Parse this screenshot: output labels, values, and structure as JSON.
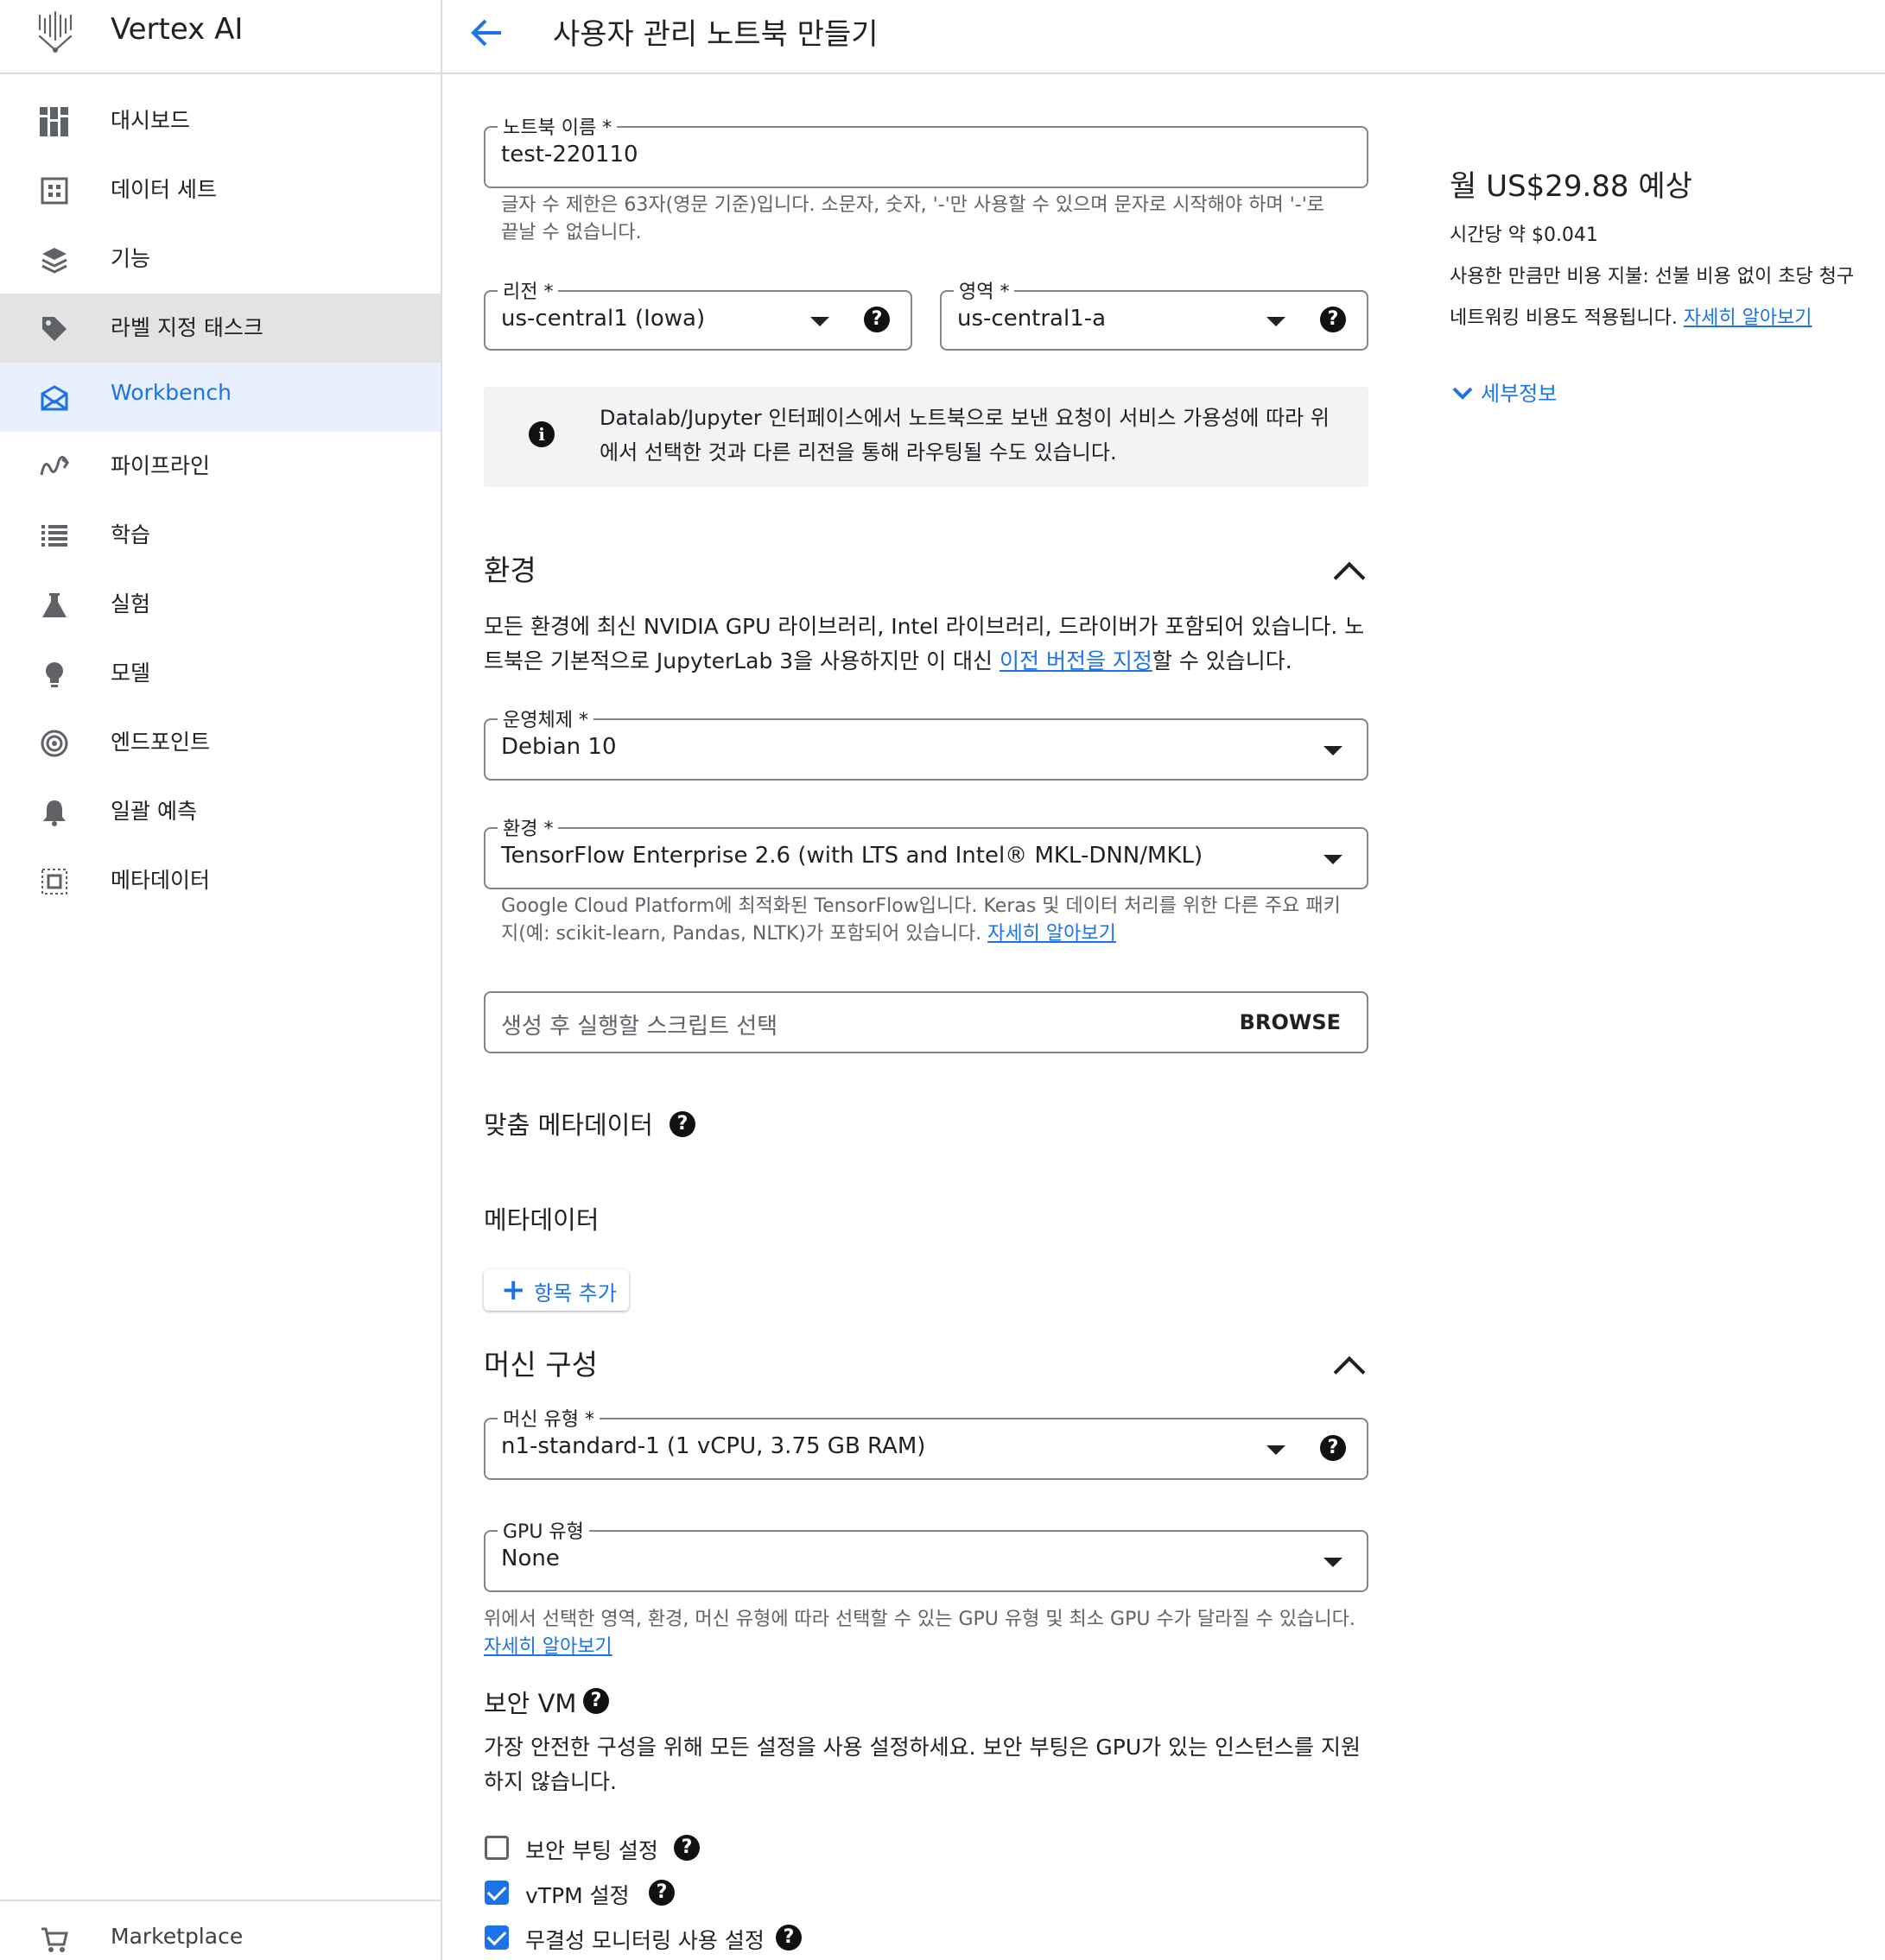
{
  "app": {
    "name": "Vertex AI"
  },
  "sidebar": {
    "items": [
      {
        "label": "대시보드",
        "icon": "dashboard-icon"
      },
      {
        "label": "데이터 세트",
        "icon": "datasets-icon"
      },
      {
        "label": "기능",
        "icon": "features-icon"
      },
      {
        "label": "라벨 지정 태스크",
        "icon": "label-tag-icon"
      },
      {
        "label": "Workbench",
        "icon": "workbench-icon"
      },
      {
        "label": "파이프라인",
        "icon": "pipelines-icon"
      },
      {
        "label": "학습",
        "icon": "training-list-icon"
      },
      {
        "label": "실험",
        "icon": "experiments-flask-icon"
      },
      {
        "label": "모델",
        "icon": "models-bulb-icon"
      },
      {
        "label": "엔드포인트",
        "icon": "endpoints-target-icon"
      },
      {
        "label": "일괄 예측",
        "icon": "batch-predictions-bell-icon"
      },
      {
        "label": "메타데이터",
        "icon": "metadata-icon"
      }
    ],
    "footer_item": {
      "label": "Marketplace",
      "icon": "marketplace-cart-icon"
    }
  },
  "header": {
    "title": "사용자 관리 노트북 만들기"
  },
  "form": {
    "notebook_name": {
      "label": "노트북 이름 *",
      "value": "test-220110",
      "hint": "글자 수 제한은 63자(영문 기준)입니다. 소문자, 숫자, '-'만 사용할 수 있으며 문자로 시작해야 하며 '-'로 끝날 수 없습니다."
    },
    "region": {
      "label": "리전 *",
      "value": "us-central1 (Iowa)"
    },
    "zone": {
      "label": "영역 *",
      "value": "us-central1-a"
    },
    "info_banner": "Datalab/Jupyter 인터페이스에서 노트북으로 보낸 요청이 서비스 가용성에 따라 위에서 선택한 것과 다른 리전을 통해 라우팅될 수도 있습니다.",
    "environment_section": {
      "title": "환경",
      "desc_before": "모든 환경에 최신 NVIDIA GPU 라이브러리, Intel 라이브러리, 드라이버가 포함되어 있습니다. 노트북은 기본적으로 JupyterLab 3을 사용하지만 이 대신 ",
      "desc_link": "이전 버전을 지정",
      "desc_after": "할 수 있습니다."
    },
    "os": {
      "label": "운영체제 *",
      "value": "Debian 10"
    },
    "environment": {
      "label": "환경 *",
      "value": "TensorFlow Enterprise 2.6 (with LTS and Intel® MKL-DNN/MKL)",
      "hint": "Google Cloud Platform에 최적화된 TensorFlow입니다. Keras 및 데이터 처리를 위한 다른 주요 패키지(예: scikit-learn, Pandas, NLTK)가 포함되어 있습니다. ",
      "hint_link": "자세히 알아보기"
    },
    "script": {
      "placeholder": "생성 후 실행할 스크립트 선택",
      "browse_label": "BROWSE"
    },
    "custom_metadata_title": "맞춤 메타데이터",
    "metadata_title": "메타데이터",
    "add_item_label": "항목 추가",
    "machine_section": {
      "title": "머신 구성"
    },
    "machine_type": {
      "label": "머신 유형 *",
      "value": "n1-standard-1 (1 vCPU, 3.75 GB RAM)"
    },
    "gpu_type": {
      "label": "GPU 유형",
      "value": "None",
      "hint": "위에서 선택한 영역, 환경, 머신 유형에 따라 선택할 수 있는 GPU 유형 및 최소 GPU 수가 달라질 수 있습니다.",
      "hint_link": "자세히 알아보기"
    },
    "shielded_vm": {
      "title": "보안 VM",
      "desc": "가장 안전한 구성을 위해 모든 설정을 사용 설정하세요. 보안 부팅은 GPU가 있는 인스턴스를 지원하지 않습니다.",
      "options": [
        {
          "label": "보안 부팅 설정",
          "checked": false
        },
        {
          "label": "vTPM 설정",
          "checked": true
        },
        {
          "label": "무결성 모니터링 사용 설정",
          "checked": true
        }
      ]
    }
  },
  "pricing": {
    "monthly": "월 US$29.88 예상",
    "hourly": "시간당 약 $0.041",
    "billing": "사용한 만큼만 비용 지불: 선불 비용 없이 초당 청구",
    "network_before": "네트워킹 비용도 적용됩니다. ",
    "network_link": "자세히 알아보기",
    "details_label": "세부정보"
  },
  "colors": {
    "accent": "#1a73e8",
    "active_bg": "#e8f0fe",
    "hover_bg": "#e3e3e3",
    "banner_bg": "#f1f3f4"
  }
}
